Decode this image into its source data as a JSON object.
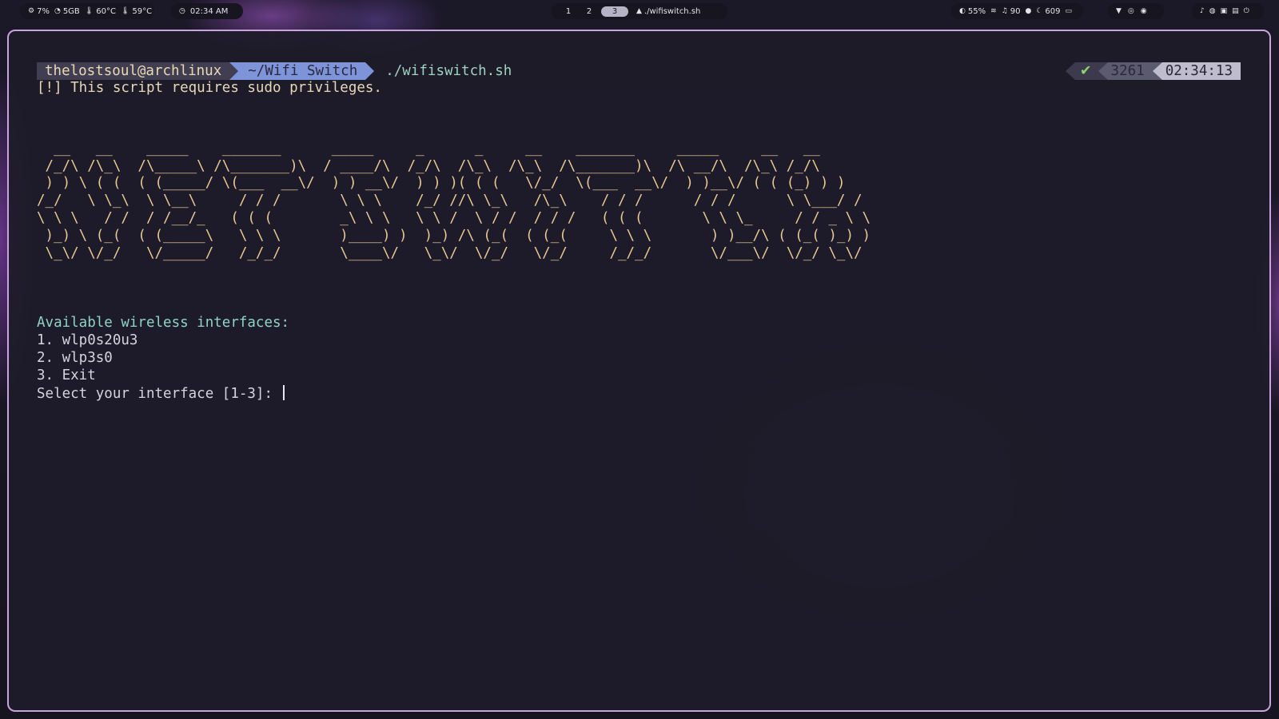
{
  "topbar": {
    "system": {
      "cpu": "7%",
      "ram": "5GB",
      "temp1": "60°C",
      "temp2": "59°C"
    },
    "clock": "02:34 AM",
    "workspaces": [
      "1",
      "2",
      "3"
    ],
    "active_workspace": "3",
    "window_title": "./wifiswitch.sh",
    "status": {
      "brightness": "55%",
      "headphones": "90",
      "mic": "609"
    }
  },
  "terminal": {
    "prompt": {
      "user_host": "thelostsoul@archlinux",
      "directory": "~/Wifi Switch",
      "command": "./wifiswitch.sh"
    },
    "right_prompt": {
      "status": "✔",
      "count": "3261",
      "time": "02:34:13"
    },
    "warning": "[!] This script requires sudo privileges.",
    "ascii_art": "  __   __    _____    _______      _____     _      _     __    _______     _____     __   __\n /_/\\ /\\_\\  /\\_____\\ /\\_______)\\  / ____/\\  /_/\\  /\\_\\  /\\_\\  /\\_______)\\  /\\ __/\\  /\\_\\ /_/\\\n ) ) \\ ( (  ( (_____/ \\(___  __\\/  ) ) __\\/  ) ) )( ( (   \\/_/  \\(___  __\\/  ) )__\\/ ( ( (_) ) )\n/_/   \\ \\_\\  \\ \\__\\     / / /       \\ \\ \\    /_/ //\\ \\_\\   /\\_\\    / / /      / / /      \\ \\___/ /\n\\ \\ \\   / /  / /__/_   ( ( (        _\\ \\ \\   \\ \\ /  \\ / /  / / /   ( ( (       \\ \\ \\_     / / _ \\ \\\n )_) \\ (_(  ( (_____\\   \\ \\ \\       )____) )  )_) /\\ (_(  ( (_(     \\ \\ \\       ) )__/\\ ( (_( )_) )\n \\_\\/ \\/_/   \\/_____/   /_/_/       \\____\\/   \\_\\/  \\/_/   \\/_/     /_/_/       \\/___\\/  \\/_/ \\_\\/",
    "menu_title": "Available wireless interfaces:",
    "options": [
      "1. wlp0s20u3",
      "2. wlp3s0",
      "3. Exit"
    ],
    "input_prompt": "Select your interface [1-3]: "
  },
  "colors": {
    "border": "#c9a3de",
    "prompt_user_bg": "#413e52",
    "prompt_dir_bg": "#7d95d8",
    "ascii": "#e8c891",
    "menu_title": "#8fd4c7",
    "ok": "#8fd36f"
  }
}
